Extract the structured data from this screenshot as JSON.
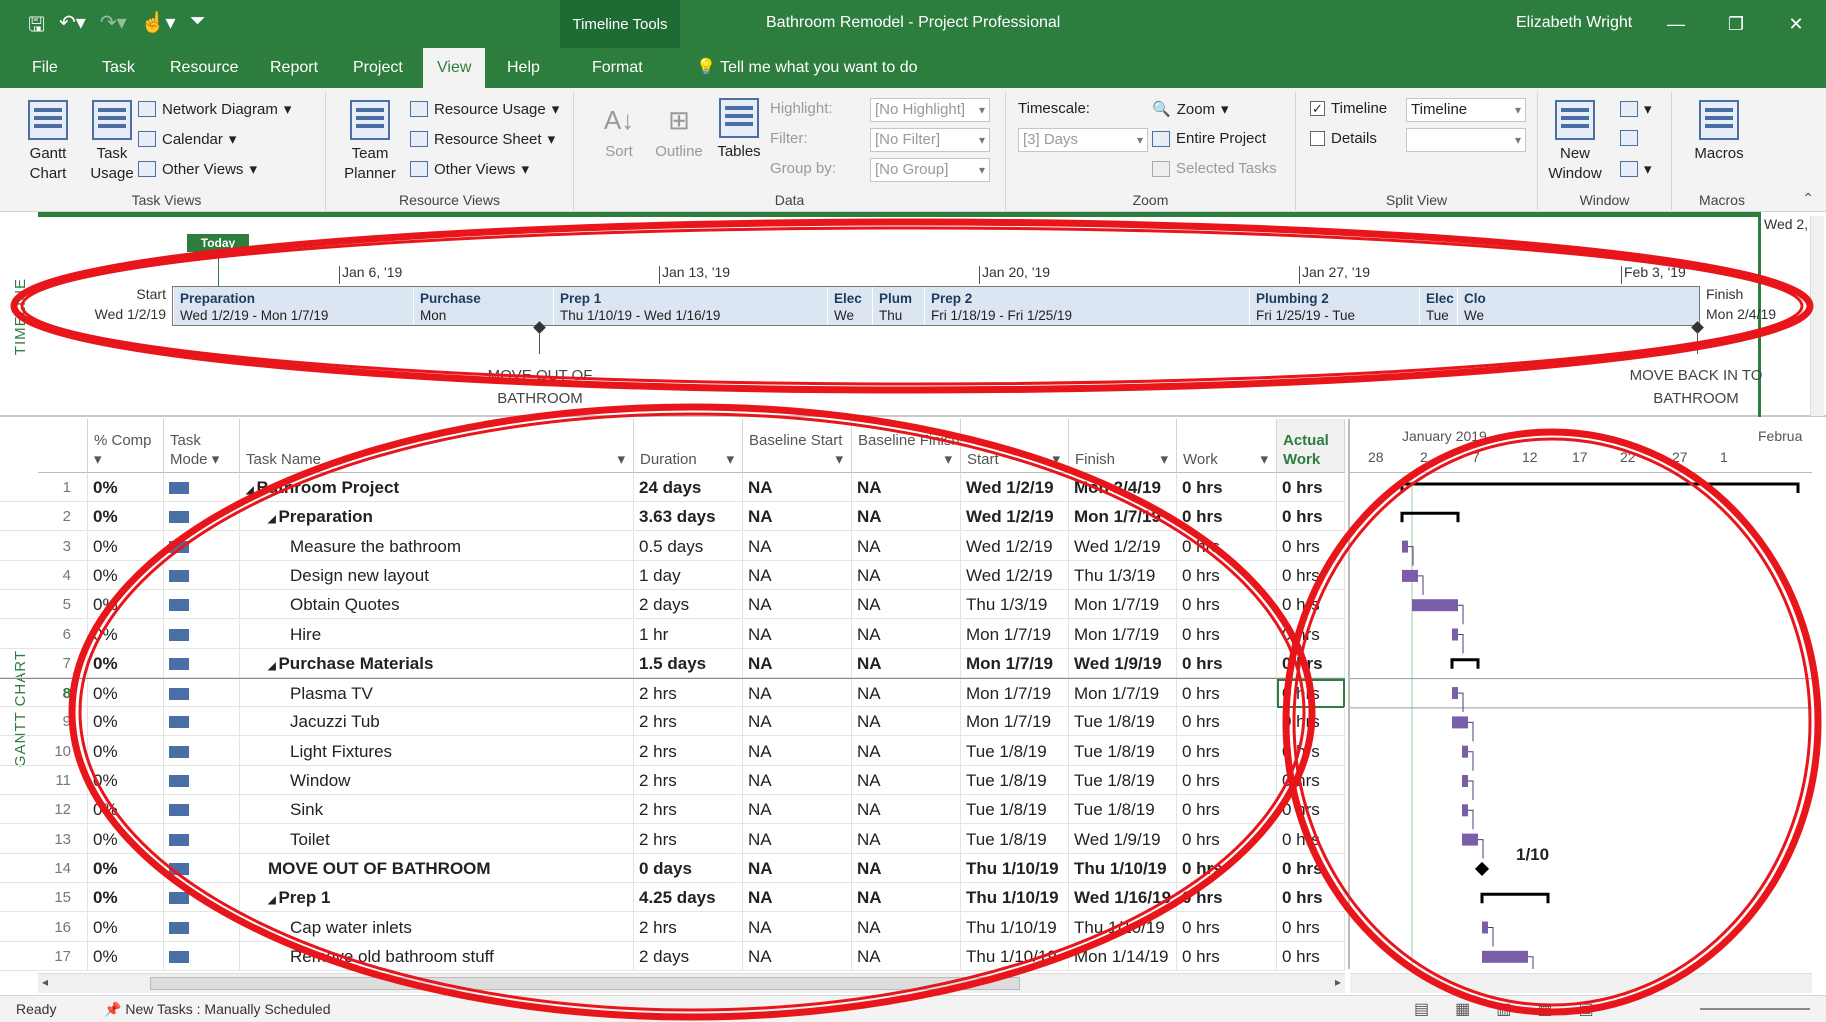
{
  "titlebar": {
    "context_tab": "Timeline Tools",
    "document_title": "Bathroom Remodel  -  Project Professional",
    "user": "Elizabeth Wright"
  },
  "tabs": [
    "File",
    "Task",
    "Resource",
    "Report",
    "Project",
    "View",
    "Help",
    "Format"
  ],
  "active_tab": "View",
  "tell_me": "Tell me what you want to do",
  "ribbon": {
    "task_views": {
      "label": "Task Views",
      "gantt_chart": "Gantt Chart",
      "task_usage": "Task Usage",
      "network_diagram": "Network Diagram",
      "calendar": "Calendar",
      "other_views": "Other Views"
    },
    "resource_views": {
      "label": "Resource Views",
      "team_planner": "Team Planner",
      "resource_usage": "Resource Usage",
      "resource_sheet": "Resource Sheet",
      "other_views": "Other Views"
    },
    "data": {
      "label": "Data",
      "sort": "Sort",
      "outline": "Outline",
      "tables": "Tables",
      "highlight_label": "Highlight:",
      "highlight_value": "[No Highlight]",
      "filter_label": "Filter:",
      "filter_value": "[No Filter]",
      "group_label": "Group by:",
      "group_value": "[No Group]"
    },
    "zoom": {
      "label": "Zoom",
      "timescale_label": "Timescale:",
      "timescale_value": "[3] Days",
      "zoom": "Zoom",
      "entire_project": "Entire Project",
      "selected_tasks": "Selected Tasks"
    },
    "split_view": {
      "label": "Split View",
      "timeline": "Timeline",
      "timeline_checked": "✓",
      "timeline_value": "Timeline",
      "details": "Details"
    },
    "window": {
      "label": "Window",
      "new_window": "New Window"
    },
    "macros": {
      "label": "Macros",
      "macros": "Macros"
    }
  },
  "timeline": {
    "vertical_label": "TIMELINE",
    "today": "Today",
    "right_date": "Wed 2,",
    "dates": [
      "Jan 6, '19",
      "Jan 13, '19",
      "Jan 20, '19",
      "Jan 27, '19",
      "Feb 3, '19"
    ],
    "start_label": "Start",
    "start_date": "Wed 1/2/19",
    "finish_label": "Finish",
    "finish_date": "Mon 2/4/19",
    "segments": [
      {
        "name": "Preparation",
        "dates": "Wed 1/2/19 - Mon 1/7/19"
      },
      {
        "name": "Purchase",
        "dates": "Mon"
      },
      {
        "name": "Prep 1",
        "dates": "Thu 1/10/19 - Wed 1/16/19"
      },
      {
        "name": "Elec",
        "dates": "We"
      },
      {
        "name": "Plum",
        "dates": "Thu"
      },
      {
        "name": "Prep 2",
        "dates": "Fri 1/18/19 - Fri 1/25/19"
      },
      {
        "name": "Plumbing 2",
        "dates": "Fri 1/25/19 - Tue"
      },
      {
        "name": "Elec",
        "dates": "Tue"
      },
      {
        "name": "Clo",
        "dates": "We"
      }
    ],
    "milestone_1": {
      "line1": "MOVE OUT OF",
      "line2": "BATHROOM"
    },
    "milestone_2": {
      "line1": "MOVE BACK IN TO",
      "line2": "BATHROOM"
    }
  },
  "gantt": {
    "vertical_label": "GANTT CHART",
    "columns": {
      "comp": "% Comp",
      "mode": "Task Mode",
      "name": "Task Name",
      "duration": "Duration",
      "baseline_start": "Baseline Start",
      "baseline_finish": "Baseline Finish",
      "start": "Start",
      "finish": "Finish",
      "work": "Work",
      "actual_work": "Actual Work"
    },
    "rows": [
      {
        "id": "1",
        "comp": "0%",
        "name": "Bathroom Project",
        "duration": "24 days",
        "bs": "NA",
        "bf": "NA",
        "start": "Wed 1/2/19",
        "finish": "Mon 2/4/19",
        "work": "0 hrs",
        "actual": "0 hrs",
        "bold": true,
        "level": 0,
        "summary": true
      },
      {
        "id": "2",
        "comp": "0%",
        "name": "Preparation",
        "duration": "3.63 days",
        "bs": "NA",
        "bf": "NA",
        "start": "Wed 1/2/19",
        "finish": "Mon 1/7/19",
        "work": "0 hrs",
        "actual": "0 hrs",
        "bold": true,
        "level": 1,
        "summary": true
      },
      {
        "id": "3",
        "comp": "0%",
        "name": "Measure the bathroom",
        "duration": "0.5 days",
        "bs": "NA",
        "bf": "NA",
        "start": "Wed 1/2/19",
        "finish": "Wed 1/2/19",
        "work": "0 hrs",
        "actual": "0 hrs",
        "bold": false,
        "level": 2
      },
      {
        "id": "4",
        "comp": "0%",
        "name": "Design new layout",
        "duration": "1 day",
        "bs": "NA",
        "bf": "NA",
        "start": "Wed 1/2/19",
        "finish": "Thu 1/3/19",
        "work": "0 hrs",
        "actual": "0 hrs",
        "bold": false,
        "level": 2
      },
      {
        "id": "5",
        "comp": "0%",
        "name": "Obtain Quotes",
        "duration": "2 days",
        "bs": "NA",
        "bf": "NA",
        "start": "Thu 1/3/19",
        "finish": "Mon 1/7/19",
        "work": "0 hrs",
        "actual": "0 hrs",
        "bold": false,
        "level": 2
      },
      {
        "id": "6",
        "comp": "0%",
        "name": "Hire",
        "duration": "1 hr",
        "bs": "NA",
        "bf": "NA",
        "start": "Mon 1/7/19",
        "finish": "Mon 1/7/19",
        "work": "0 hrs",
        "actual": "0 hrs",
        "bold": false,
        "level": 2
      },
      {
        "id": "7",
        "comp": "0%",
        "name": "Purchase Materials",
        "duration": "1.5 days",
        "bs": "NA",
        "bf": "NA",
        "start": "Mon 1/7/19",
        "finish": "Wed 1/9/19",
        "work": "0 hrs",
        "actual": "0 hrs",
        "bold": true,
        "level": 1,
        "summary": true
      },
      {
        "id": "8",
        "comp": "0%",
        "name": "Plasma TV",
        "duration": "2 hrs",
        "bs": "NA",
        "bf": "NA",
        "start": "Mon 1/7/19",
        "finish": "Mon 1/7/19",
        "work": "0 hrs",
        "actual": "0 hrs",
        "bold": false,
        "level": 2,
        "selected": true
      },
      {
        "id": "9",
        "comp": "0%",
        "name": "Jacuzzi Tub",
        "duration": "2 hrs",
        "bs": "NA",
        "bf": "NA",
        "start": "Mon 1/7/19",
        "finish": "Tue 1/8/19",
        "work": "0 hrs",
        "actual": "0 hrs",
        "bold": false,
        "level": 2
      },
      {
        "id": "10",
        "comp": "0%",
        "name": "Light Fixtures",
        "duration": "2 hrs",
        "bs": "NA",
        "bf": "NA",
        "start": "Tue 1/8/19",
        "finish": "Tue 1/8/19",
        "work": "0 hrs",
        "actual": "0 hrs",
        "bold": false,
        "level": 2
      },
      {
        "id": "11",
        "comp": "0%",
        "name": "Window",
        "duration": "2 hrs",
        "bs": "NA",
        "bf": "NA",
        "start": "Tue 1/8/19",
        "finish": "Tue 1/8/19",
        "work": "0 hrs",
        "actual": "0 hrs",
        "bold": false,
        "level": 2
      },
      {
        "id": "12",
        "comp": "0%",
        "name": "Sink",
        "duration": "2 hrs",
        "bs": "NA",
        "bf": "NA",
        "start": "Tue 1/8/19",
        "finish": "Tue 1/8/19",
        "work": "0 hrs",
        "actual": "0 hrs",
        "bold": false,
        "level": 2
      },
      {
        "id": "13",
        "comp": "0%",
        "name": "Toilet",
        "duration": "2 hrs",
        "bs": "NA",
        "bf": "NA",
        "start": "Tue 1/8/19",
        "finish": "Wed 1/9/19",
        "work": "0 hrs",
        "actual": "0 hrs",
        "bold": false,
        "level": 2
      },
      {
        "id": "14",
        "comp": "0%",
        "name": "MOVE OUT OF BATHROOM",
        "duration": "0 days",
        "bs": "NA",
        "bf": "NA",
        "start": "Thu 1/10/19",
        "finish": "Thu 1/10/19",
        "work": "0 hrs",
        "actual": "0 hrs",
        "bold": true,
        "level": 1
      },
      {
        "id": "15",
        "comp": "0%",
        "name": "Prep 1",
        "duration": "4.25 days",
        "bs": "NA",
        "bf": "NA",
        "start": "Thu 1/10/19",
        "finish": "Wed 1/16/19",
        "work": "0 hrs",
        "actual": "0 hrs",
        "bold": true,
        "level": 1,
        "summary": true
      },
      {
        "id": "16",
        "comp": "0%",
        "name": "Cap water inlets",
        "duration": "2 hrs",
        "bs": "NA",
        "bf": "NA",
        "start": "Thu 1/10/19",
        "finish": "Thu 1/10/19",
        "work": "0 hrs",
        "actual": "0 hrs",
        "bold": false,
        "level": 2
      },
      {
        "id": "17",
        "comp": "0%",
        "name": "Remove old bathroom stuff",
        "duration": "2 days",
        "bs": "NA",
        "bf": "NA",
        "start": "Thu 1/10/19",
        "finish": "Mon 1/14/19",
        "work": "0 hrs",
        "actual": "0 hrs",
        "bold": false,
        "level": 2
      }
    ],
    "chart_header": {
      "month1": "January 2019",
      "month2": "Februa",
      "days": [
        "28",
        "2",
        "7",
        "12",
        "17",
        "22",
        "27",
        "1"
      ]
    },
    "milestone_label": "1/10"
  },
  "statusbar": {
    "ready": "Ready",
    "new_tasks": "New Tasks : Manually Scheduled"
  }
}
